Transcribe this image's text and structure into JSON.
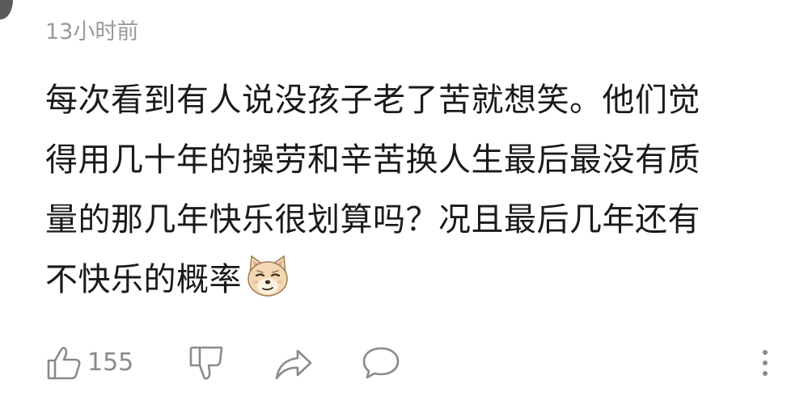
{
  "comment": {
    "timestamp": "13小时前",
    "text_lines": [
      "每次看到有人说没孩子老了苦就想笑。他们觉",
      "得用几十年的操劳和辛苦换人生最后最没有质",
      "量的那几年快乐很划算吗？况且最后几年还有",
      "不快乐的概率"
    ],
    "emoji": "smirking-dog-emoji",
    "actions": {
      "like_icon": "thumbs-up-icon",
      "like_count": "155",
      "dislike_icon": "thumbs-down-icon",
      "share_icon": "share-arrow-icon",
      "reply_icon": "chat-bubble-icon",
      "more_icon": "more-vertical-icon"
    }
  }
}
